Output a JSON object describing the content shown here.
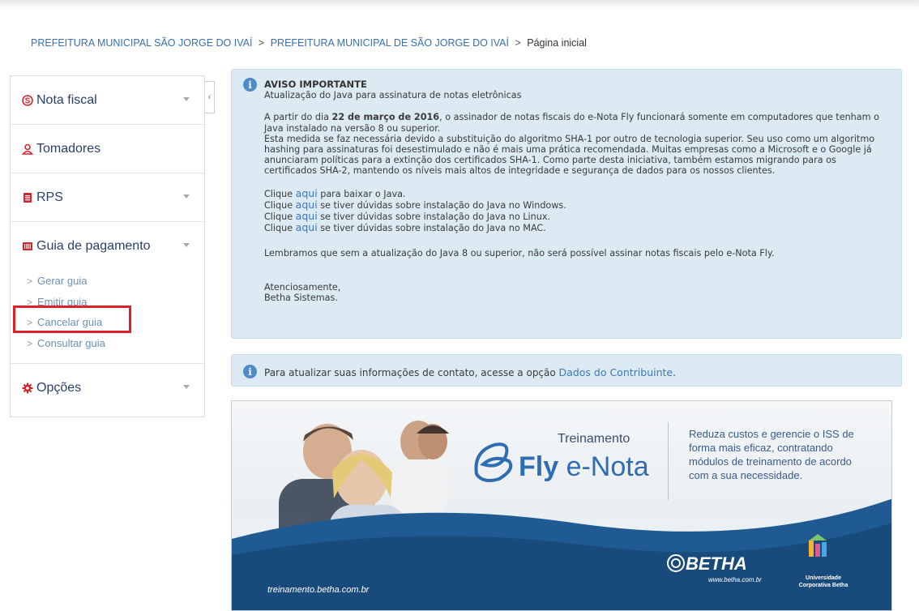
{
  "breadcrumb": {
    "item1": "PREFEITURA MUNICIPAL SÃO JORGE DO IVAÍ",
    "sep1": ">",
    "item2": "PREFEITURA MUNICIPAL DE SÃO JORGE DO IVAÍ",
    "sep2": ">",
    "current": "Página inicial"
  },
  "sidebar": {
    "nota_fiscal": "Nota fiscal",
    "tomadores": "Tomadores",
    "rps": "RPS",
    "guia_pagamento": "Guia de pagamento",
    "guia_items": [
      "Gerar guia",
      "Emitir guia",
      "Cancelar guia",
      "Consultar guia"
    ],
    "opcoes": "Opções",
    "collapse": "‹"
  },
  "colors": {
    "accent": "#d8232a",
    "menu_text": "#2a3f6b",
    "link": "#3a78b8",
    "panel_bg": "#dceaf3"
  },
  "aviso": {
    "title": "AVISO IMPORTANTE",
    "subtitle": "Atualização do Java para assinatura de notas eletrônicas",
    "p1_pre": "A partir do dia ",
    "p1_date": "22 de março de 2016",
    "p1_post": ", o assinador de notas fiscais do e-Nota Fly funcionará somente em computadores que tenham o Java instalado na versão 8 ou superior.",
    "p2": "Esta medida se faz necessária devido a substituição do algoritmo SHA-1 por outro de tecnologia superior. Seu uso como um algoritmo hashing para assinaturas foi desestimulado e não é mais uma prática recomendada. Muitas empresas como a Microsoft e o Google já anunciaram políticas para a extinção dos certificados SHA-1. Como parte desta iniciativa, também estamos migrando para os certificados SHA-2, mantendo os níveis mais altos de integridade e segurança de dados para os nossos clientes.",
    "clique": "Clique",
    "aqui": "aqui",
    "l1": " para baixar o Java.",
    "l2": " se tiver dúvidas sobre instalação do Java no Windows.",
    "l3": " se tiver dúvidas sobre instalação do Java no Linux.",
    "l4": " se tiver dúvidas sobre instalação do Java no MAC.",
    "lembramos": "Lembramos que sem a atualização do Java 8 ou superior, não será possível assinar notas fiscais pelo e-Nota Fly.",
    "atenciosamente": "Atenciosamente,",
    "signature": "Betha Sistemas."
  },
  "contato": {
    "text": "Para atualizar suas informações de contato, acesse a opção ",
    "link": "Dados do Contribuinte",
    "end": "."
  },
  "banner": {
    "treinamento": "Treinamento",
    "fly": "Fly",
    "enota": " e-Nota",
    "desc": "Reduza custos e gerencie o ISS de forma mais eficaz, contratando módulos de treinamento de acordo com a sua necessidade.",
    "url": "treinamento.betha.com.br",
    "betha": "BETHA",
    "betha_url": "www.betha.com.br",
    "uni1": "Universidade",
    "uni2": "Corporativa Betha"
  }
}
